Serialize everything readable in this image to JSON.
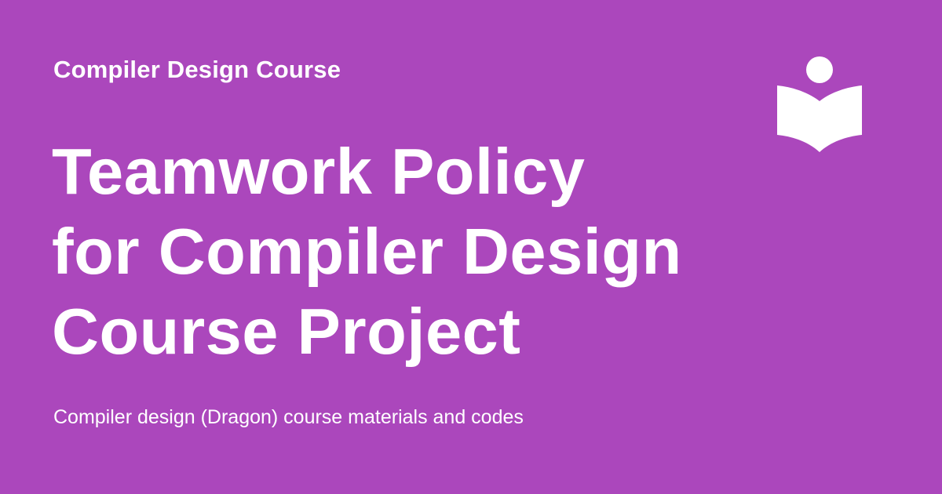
{
  "site": {
    "name": "Compiler Design Course"
  },
  "page": {
    "title_lines": [
      "Teamwork Policy",
      "for Compiler Design",
      "Course Project"
    ],
    "description": "Compiler design (Dragon) course materials and codes"
  },
  "logo": {
    "icon": "reader-book-icon"
  },
  "colors": {
    "background": "#ab47bc",
    "foreground": "#ffffff"
  }
}
